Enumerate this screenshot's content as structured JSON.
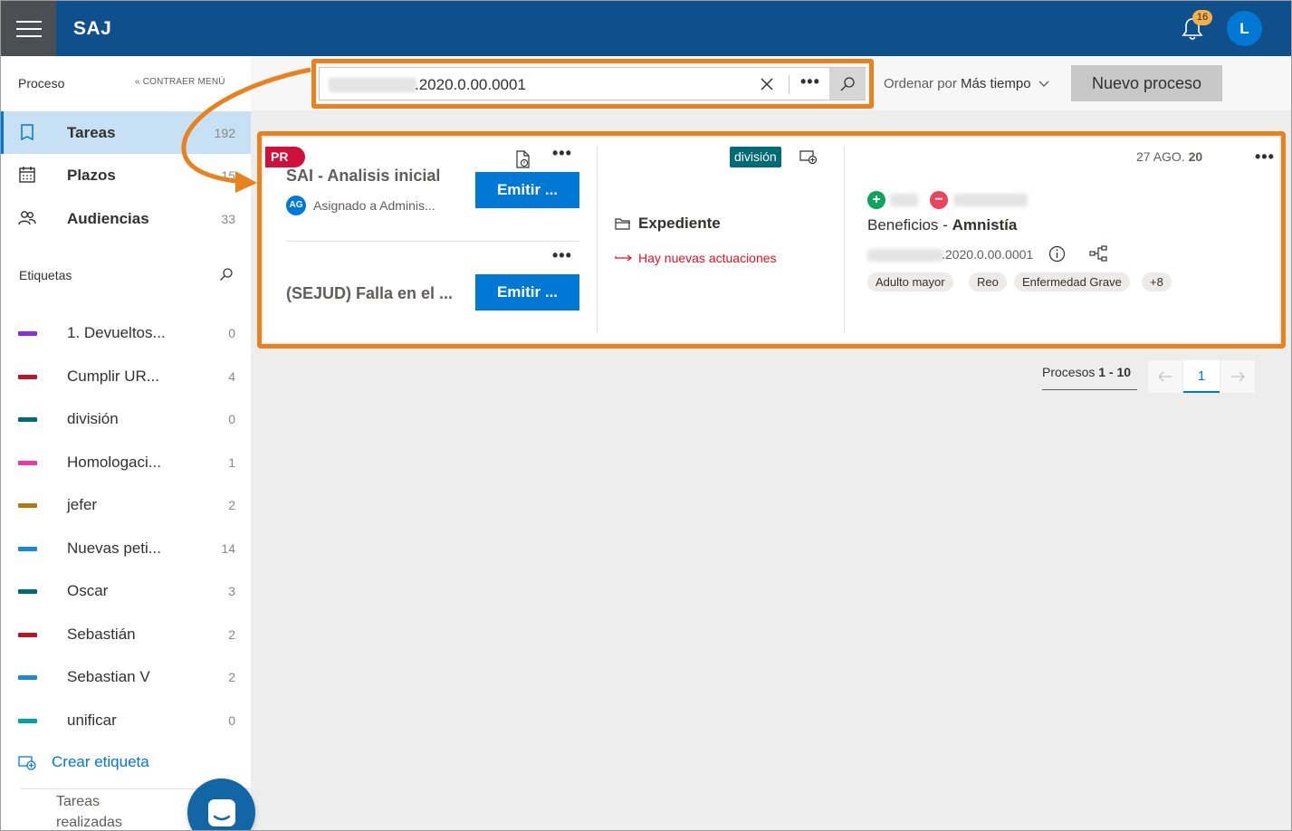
{
  "header": {
    "brand": "SAJ",
    "notifications": "16",
    "avatar": "L"
  },
  "sidebar": {
    "section": "Proceso",
    "collapse": "CONTRAER MENÚ",
    "nav": [
      {
        "label": "Tareas",
        "count": "192"
      },
      {
        "label": "Plazos",
        "count": "15"
      },
      {
        "label": "Audiencias",
        "count": "33"
      }
    ],
    "tags_heading": "Etiquetas",
    "tags": [
      {
        "label": "1. Devueltos...",
        "count": "0",
        "color": "#8a2be2"
      },
      {
        "label": "Cumplir UR...",
        "count": "4",
        "color": "#b4182a"
      },
      {
        "label": "división",
        "count": "0",
        "color": "#006b75"
      },
      {
        "label": "Homologaci...",
        "count": "1",
        "color": "#e83aa8"
      },
      {
        "label": "jefer",
        "count": "2",
        "color": "#b07a12"
      },
      {
        "label": "Nuevas peti...",
        "count": "14",
        "color": "#1b8ad6"
      },
      {
        "label": "Oscar",
        "count": "3",
        "color": "#006b75"
      },
      {
        "label": "Sebastián",
        "count": "2",
        "color": "#b4182a"
      },
      {
        "label": "Sebastian V",
        "count": "2",
        "color": "#1b8ad6"
      },
      {
        "label": "unificar",
        "count": "0",
        "color": "#00a0a8"
      }
    ],
    "create_tag": "Crear etiqueta",
    "done": "Tareas realizadas"
  },
  "toolbar": {
    "search_value": ".2020.0.00.0001",
    "sort_prefix": "Ordenar por",
    "sort_value": "Más tiempo",
    "new_process": "Nuevo proceso"
  },
  "card": {
    "badge": "PR",
    "tasks": [
      {
        "title": "SAI - Analisis inicial",
        "assigned": "Asignado a Adminis...",
        "assigned_initials": "AG",
        "action": "Emitir ..."
      },
      {
        "title": "(SEJUD) Falla en el ...",
        "action": "Emitir ..."
      }
    ],
    "tag": "división",
    "file_label": "Expediente",
    "news": "Hay nuevas actuaciones",
    "date_prefix": "27 AGO.",
    "date_year": "20",
    "subject_prefix": "Beneficios -",
    "subject_bold": "Amnistía",
    "file_number": ".2020.0.00.0001",
    "chips": [
      "Adulto mayor",
      "Reo",
      "Enfermedad Grave",
      "+8"
    ]
  },
  "pagination": {
    "label_prefix": "Procesos",
    "range": "1 - 10",
    "current": "1"
  }
}
